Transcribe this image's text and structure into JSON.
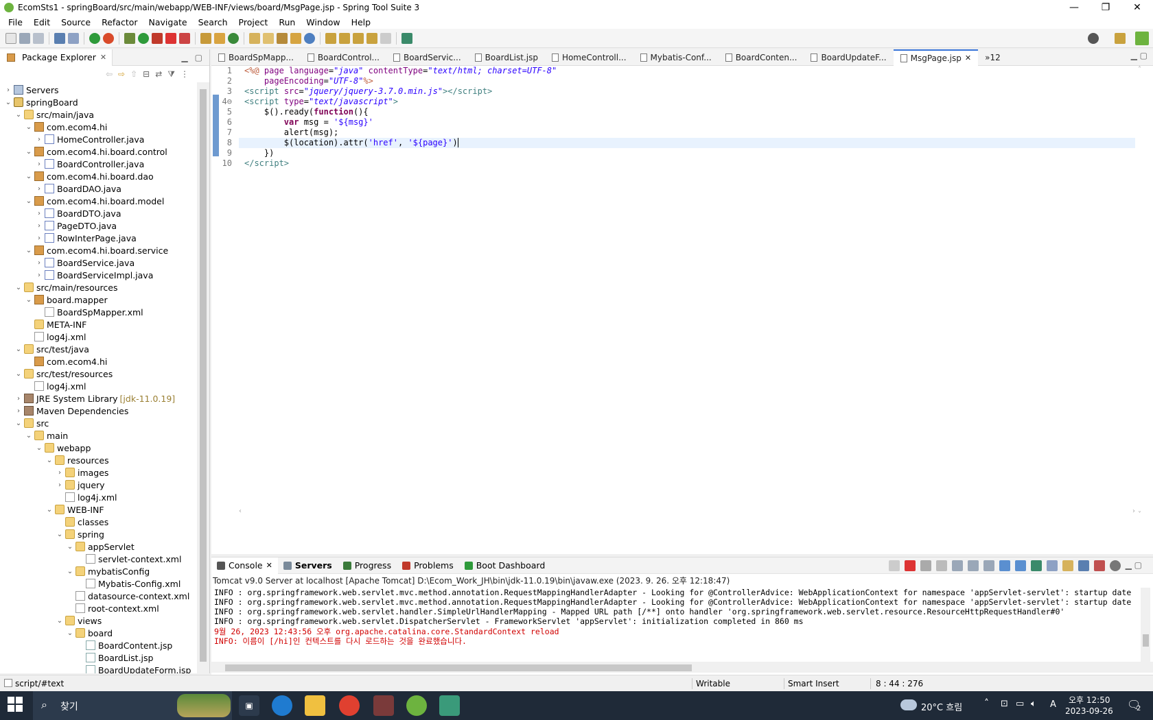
{
  "window": {
    "title": "EcomSts1 - springBoard/src/main/webapp/WEB-INF/views/board/MsgPage.jsp - Spring Tool Suite 3",
    "controls": {
      "minimize": "—",
      "maximize": "❐",
      "close": "✕"
    }
  },
  "menu": [
    "File",
    "Edit",
    "Source",
    "Refactor",
    "Navigate",
    "Search",
    "Project",
    "Run",
    "Window",
    "Help"
  ],
  "explorer": {
    "tab_label": "Package Explorer",
    "tree": [
      {
        "label": "Servers",
        "icon": "folder-icon",
        "kind": "server"
      },
      {
        "label": "springBoard",
        "icon": "project-icon",
        "kind": "proj"
      },
      {
        "label": "src/main/java",
        "icon": "source-folder-icon",
        "kind": "folder"
      },
      {
        "label": "com.ecom4.hi",
        "icon": "package-icon",
        "kind": "pkg"
      },
      {
        "label": "HomeController.java",
        "icon": "java-file-icon",
        "kind": "java"
      },
      {
        "label": "com.ecom4.hi.board.control",
        "icon": "package-icon",
        "kind": "pkg"
      },
      {
        "label": "BoardController.java",
        "icon": "java-file-icon",
        "kind": "java"
      },
      {
        "label": "com.ecom4.hi.board.dao",
        "icon": "package-icon",
        "kind": "pkg"
      },
      {
        "label": "BoardDAO.java",
        "icon": "java-file-icon",
        "kind": "java"
      },
      {
        "label": "com.ecom4.hi.board.model",
        "icon": "package-icon",
        "kind": "pkg"
      },
      {
        "label": "BoardDTO.java",
        "icon": "java-file-icon",
        "kind": "java"
      },
      {
        "label": "PageDTO.java",
        "icon": "java-file-icon",
        "kind": "java"
      },
      {
        "label": "RowInterPage.java",
        "icon": "java-file-icon",
        "kind": "java"
      },
      {
        "label": "com.ecom4.hi.board.service",
        "icon": "package-icon",
        "kind": "pkg"
      },
      {
        "label": "BoardService.java",
        "icon": "java-file-icon",
        "kind": "java"
      },
      {
        "label": "BoardServiceImpl.java",
        "icon": "java-file-icon",
        "kind": "java"
      },
      {
        "label": "src/main/resources",
        "icon": "source-folder-icon",
        "kind": "folder"
      },
      {
        "label": "board.mapper",
        "icon": "package-icon",
        "kind": "pkg"
      },
      {
        "label": "BoardSpMapper.xml",
        "icon": "xml-file-icon",
        "kind": "xml"
      },
      {
        "label": "META-INF",
        "icon": "folder-icon",
        "kind": "folder"
      },
      {
        "label": "log4j.xml",
        "icon": "xml-file-icon",
        "kind": "xml"
      },
      {
        "label": "src/test/java",
        "icon": "source-folder-icon",
        "kind": "folder"
      },
      {
        "label": "com.ecom4.hi",
        "icon": "package-icon",
        "kind": "pkg"
      },
      {
        "label": "src/test/resources",
        "icon": "source-folder-icon",
        "kind": "folder"
      },
      {
        "label": "log4j.xml",
        "icon": "xml-file-icon",
        "kind": "xml"
      },
      {
        "label": "JRE System Library",
        "icon": "library-icon",
        "kind": "lib",
        "suffix": "[jdk-11.0.19]"
      },
      {
        "label": "Maven Dependencies",
        "icon": "library-icon",
        "kind": "lib"
      },
      {
        "label": "src",
        "icon": "folder-icon",
        "kind": "folder"
      },
      {
        "label": "main",
        "icon": "folder-icon",
        "kind": "folder"
      },
      {
        "label": "webapp",
        "icon": "folder-icon",
        "kind": "folder"
      },
      {
        "label": "resources",
        "icon": "folder-icon",
        "kind": "folder"
      },
      {
        "label": "images",
        "icon": "folder-icon",
        "kind": "folder"
      },
      {
        "label": "jquery",
        "icon": "folder-icon",
        "kind": "folder"
      },
      {
        "label": "log4j.xml",
        "icon": "xml-file-icon",
        "kind": "xml"
      },
      {
        "label": "WEB-INF",
        "icon": "folder-icon",
        "kind": "folder"
      },
      {
        "label": "classes",
        "icon": "folder-icon",
        "kind": "folder"
      },
      {
        "label": "spring",
        "icon": "folder-icon",
        "kind": "folder"
      },
      {
        "label": "appServlet",
        "icon": "folder-icon",
        "kind": "folder"
      },
      {
        "label": "servlet-context.xml",
        "icon": "xml-file-icon",
        "kind": "xml"
      },
      {
        "label": "mybatisConfig",
        "icon": "folder-icon",
        "kind": "folder"
      },
      {
        "label": "Mybatis-Config.xml",
        "icon": "xml-file-icon",
        "kind": "xml"
      },
      {
        "label": "datasource-context.xml",
        "icon": "xml-file-icon",
        "kind": "xml"
      },
      {
        "label": "root-context.xml",
        "icon": "xml-file-icon",
        "kind": "xml"
      },
      {
        "label": "views",
        "icon": "folder-icon",
        "kind": "folder"
      },
      {
        "label": "board",
        "icon": "folder-icon",
        "kind": "folder"
      },
      {
        "label": "BoardContent.jsp",
        "icon": "jsp-file-icon",
        "kind": "jsp"
      },
      {
        "label": "BoardList.jsp",
        "icon": "jsp-file-icon",
        "kind": "jsp"
      },
      {
        "label": "BoardUpdateForm.jsp",
        "icon": "jsp-file-icon",
        "kind": "jsp"
      }
    ]
  },
  "editor": {
    "tabs": [
      "BoardSpMapp...",
      "BoardControl...",
      "BoardServic...",
      "BoardList.jsp",
      "HomeControll...",
      "Mybatis-Conf...",
      "BoardConten...",
      "BoardUpdateF...",
      "MsgPage.jsp"
    ],
    "active_tab": "MsgPage.jsp",
    "overflow": "»12",
    "line_numbers": [
      "1",
      "2",
      "3",
      "4⊖",
      "5",
      "6",
      "7",
      "8",
      "9",
      "10"
    ],
    "current_line": 8
  },
  "console": {
    "tabs": [
      "Console",
      "Servers",
      "Progress",
      "Problems",
      "Boot Dashboard"
    ],
    "description": "Tomcat v9.0 Server at localhost [Apache Tomcat] D:\\Ecom_Work_JH\\bin\\jdk-11.0.19\\bin\\javaw.exe  (2023. 9. 26. 오후 12:18:47)",
    "lines": [
      {
        "text": "INFO : org.springframework.web.servlet.mvc.method.annotation.RequestMappingHandlerAdapter - Looking for @ControllerAdvice: WebApplicationContext for namespace 'appServlet-servlet': startup date",
        "color": "black"
      },
      {
        "text": "INFO : org.springframework.web.servlet.mvc.method.annotation.RequestMappingHandlerAdapter - Looking for @ControllerAdvice: WebApplicationContext for namespace 'appServlet-servlet': startup date",
        "color": "black"
      },
      {
        "text": "INFO : org.springframework.web.servlet.handler.SimpleUrlHandlerMapping - Mapped URL path [/**] onto handler 'org.springframework.web.servlet.resource.ResourceHttpRequestHandler#0'",
        "color": "black"
      },
      {
        "text": "INFO : org.springframework.web.servlet.DispatcherServlet - FrameworkServlet 'appServlet': initialization completed in 860 ms",
        "color": "black"
      },
      {
        "text": "9월 26, 2023 12:43:56 오후 org.apache.catalina.core.StandardContext reload",
        "color": "red"
      },
      {
        "text": "INFO: 이름이 [/hi]인 컨텍스트를 다시 로드하는 것을 완료했습니다.",
        "color": "red"
      }
    ]
  },
  "status": {
    "path": "script/#text",
    "writable": "Writable",
    "insert_mode": "Smart Insert",
    "position": "8 : 44 : 276"
  },
  "taskbar": {
    "search_label": "찾기",
    "weather": "20°C 흐림",
    "time": "오후 12:50",
    "date": "2023-09-26",
    "notif_count": "2",
    "ime": "A"
  },
  "colors": {
    "accent": "#3874d8",
    "console_error": "#d00000",
    "taskbar_bg": "#1f2a38"
  }
}
